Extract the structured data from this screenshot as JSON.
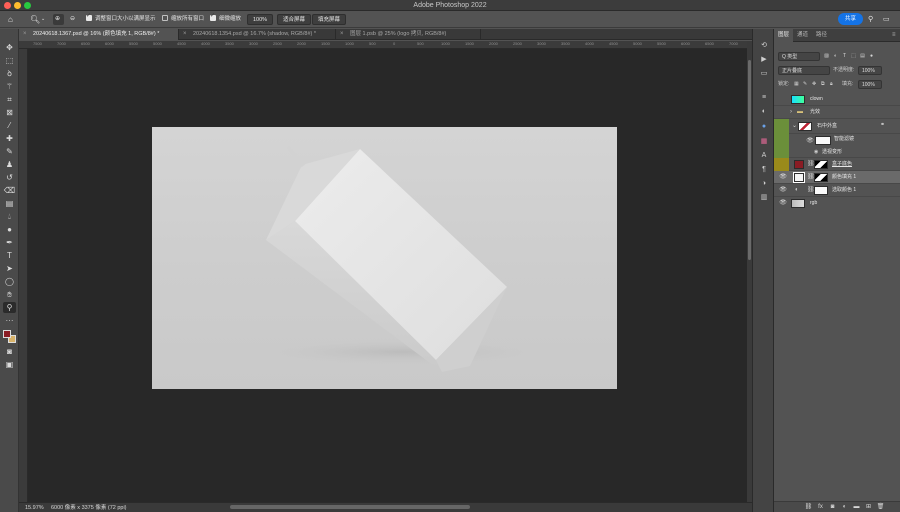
{
  "window": {
    "title": "Adobe Photoshop 2022"
  },
  "options_bar": {
    "resize_windows_label": "调整窗口大小以满屏显示",
    "zoom_all_windows_label": "缩放所有窗口",
    "scrubby_zoom_label": "细微缩放",
    "zoom_percent": "100%",
    "fit_screen_label": "适合屏幕",
    "fill_screen_label": "填充屏幕",
    "share_label": "共享"
  },
  "tabs": [
    {
      "label": "20240618.1367.psd @ 16% (颜色填充 1, RGB/8#) *",
      "active": true
    },
    {
      "label": "20240618.1354.psd @ 16.7% (shadow, RGB/8#) *",
      "active": false
    },
    {
      "label": "图层 1.psb @ 25% (logo 拷贝, RGB/8#)",
      "active": false
    }
  ],
  "ruler_top": [
    "7500",
    "7000",
    "6500",
    "6000",
    "5500",
    "5000",
    "4500",
    "4000",
    "3500",
    "3000",
    "2500",
    "2000",
    "1500",
    "1000",
    "500",
    "0",
    "500",
    "1000",
    "1500",
    "2000",
    "2500",
    "3000",
    "3500",
    "4000",
    "4500",
    "5000",
    "5500",
    "6000",
    "6500",
    "7000",
    "7500"
  ],
  "status": {
    "zoom": "15.97%",
    "doc_info": "6000 像素 x 3375 像素 (72 ppi)"
  },
  "layers_panel": {
    "tabs": [
      "图层",
      "通道",
      "路径"
    ],
    "kind_filter": "Q 类型",
    "blend_mode": "正片叠底",
    "opacity_label": "不透明度:",
    "opacity": "100%",
    "lock_label": "锁定:",
    "fill_label": "填充:",
    "fill": "100%",
    "layers": [
      {
        "name": "clown",
        "visible": false,
        "tag_color": "",
        "thumb": "cyan"
      },
      {
        "name": "光效",
        "visible": false,
        "tag_color": "",
        "thumb": "folder"
      },
      {
        "name": "石中外盒",
        "visible": false,
        "tag_color": "#6b8f3a",
        "thumb": "smart"
      },
      {
        "name": "智能滤镜",
        "visible": true,
        "tag_color": "#6b8f3a",
        "thumb": "white"
      },
      {
        "name": "透视变形",
        "visible": false,
        "tag_color": "#6b8f3a",
        "thumb": "none"
      },
      {
        "name": "盒子底色",
        "visible": false,
        "tag_color": "#9a8a1a",
        "thumb": "darkred"
      },
      {
        "name": "颜色填充 1",
        "visible": true,
        "tag_color": "",
        "thumb": "white",
        "selected": true
      },
      {
        "name": "选取颜色 1",
        "visible": true,
        "tag_color": "",
        "thumb": "adjust"
      },
      {
        "name": "rgb",
        "visible": true,
        "tag_color": "",
        "thumb": "gray"
      }
    ]
  },
  "colors": {
    "foreground": "#8a1c24",
    "background": "#d8b36a",
    "accent": "#1473e6",
    "selection": "#4a6a94"
  }
}
